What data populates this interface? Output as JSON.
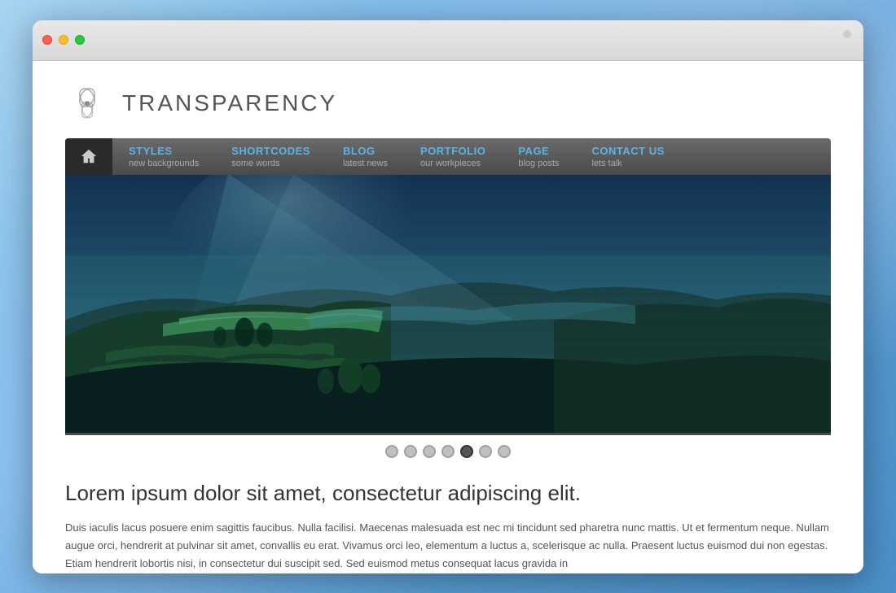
{
  "background": {
    "color_start": "#a8d4f0",
    "color_end": "#4a8fc8"
  },
  "browser": {
    "chrome_dots": [
      "red",
      "yellow",
      "green"
    ]
  },
  "site": {
    "title": "TRANSPARENCY",
    "logo_alt": "Transparency logo"
  },
  "nav": {
    "home_label": "Home",
    "items": [
      {
        "title": "STYLES",
        "subtitle": "new backgrounds"
      },
      {
        "title": "SHORTCODES",
        "subtitle": "some words"
      },
      {
        "title": "BLOG",
        "subtitle": "latest news"
      },
      {
        "title": "PORTFOLIO",
        "subtitle": "our workpieces"
      },
      {
        "title": "PAGE",
        "subtitle": "blog posts"
      },
      {
        "title": "CONTACT US",
        "subtitle": "lets talk"
      }
    ]
  },
  "slider": {
    "dots_count": 7,
    "active_dot": 4,
    "hero_alt": "Landscape hero image"
  },
  "content": {
    "heading": "Lorem ipsum dolor sit amet, consectetur adipiscing elit.",
    "body": "Duis iaculis lacus posuere enim sagittis faucibus. Nulla facilisi. Maecenas malesuada est nec mi tincidunt sed pharetra nunc mattis. Ut et fermentum neque. Nullam augue orci, hendrerit at pulvinar sit amet, convallis eu erat. Vivamus orci leo, elementum a luctus a, scelerisque ac nulla. Praesent luctus euismod dui non egestas. Etiam hendrerit lobortis nisi, in consectetur dui suscipit sed. Sed euismod metus consequat lacus gravida in"
  }
}
